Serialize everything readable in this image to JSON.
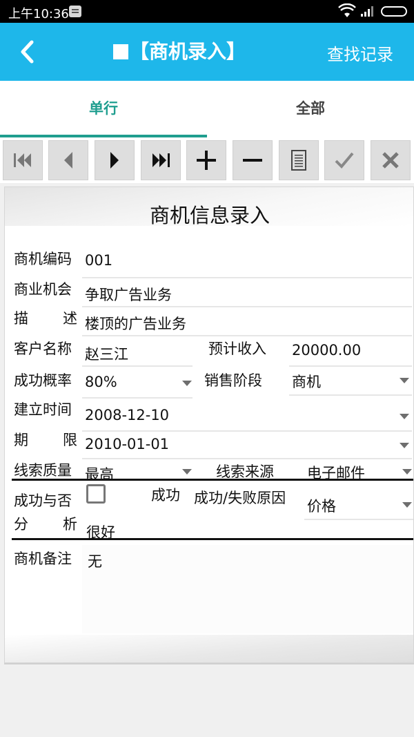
{
  "status_bar": {
    "time": "上午10:36",
    "icons": [
      "notification-icon",
      "wifi-icon",
      "signal-icon",
      "battery-icon"
    ]
  },
  "app_bar": {
    "title": "【商机录入】",
    "action": "查找记录",
    "background": "#1eb7ea"
  },
  "tabs": [
    {
      "label": "单行",
      "active": true
    },
    {
      "label": "全部",
      "active": false
    }
  ],
  "toolbar": {
    "buttons": [
      "first-record-icon",
      "previous-icon",
      "next-icon",
      "last-record-icon",
      "add-icon",
      "remove-icon",
      "list-icon",
      "confirm-icon",
      "cancel-icon"
    ]
  },
  "form": {
    "title": "商机信息录入",
    "code_label": "商机编码",
    "code_value": "001",
    "opportunity_label": "商业机会",
    "opportunity_value": "争取广告业务",
    "desc_label_1": "描",
    "desc_label_2": "述",
    "desc_value": "楼顶的广告业务",
    "customer_label": "客户名称",
    "customer_value": "赵三江",
    "income_label": "预计收入",
    "income_value": "20000.00",
    "probability_label": "成功概率",
    "probability_value": "80%",
    "stage_label": "销售阶段",
    "stage_value": "商机",
    "created_label": "建立时间",
    "created_value": "2008-12-10",
    "deadline_label_1": "期",
    "deadline_label_2": "限",
    "deadline_value": "2010-01-01",
    "lead_quality_label": "线索质量",
    "lead_quality_value": "最高",
    "lead_source_label": "线索来源",
    "lead_source_value": "电子邮件",
    "success_label": "成功与否",
    "success_checkbox_label": "成功",
    "success_checked": false,
    "reason_label": "成功/失败原因",
    "reason_value": "价格",
    "analysis_label_1": "分",
    "analysis_label_2": "析",
    "analysis_value": "很好",
    "remarks_label": "商机备注",
    "remarks_value": "无"
  },
  "colors": {
    "accent": "#1eb7ea",
    "tab_active": "#1f9e8f"
  }
}
